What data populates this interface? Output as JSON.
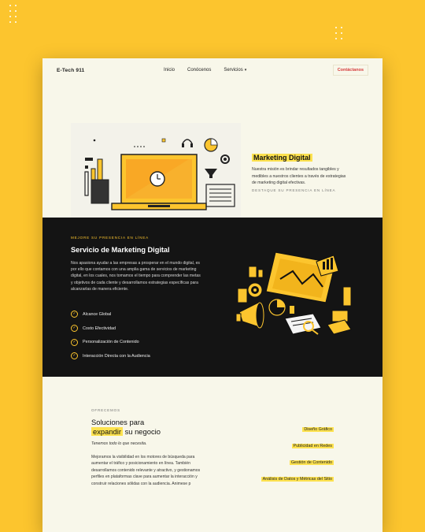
{
  "nav": {
    "brand": "E-Tech 911",
    "links": [
      "Inicio",
      "Conócenos",
      "Servicios"
    ],
    "contact": "Contáctanos"
  },
  "hero": {
    "title": "Marketing Digital",
    "description": "Nuestra misión es brindar resultados tangibles y medibles a nuestros clientes a través de estrategias de marketing digital efectivas.",
    "kicker": "Destaque su presencia en línea"
  },
  "service_section": {
    "kicker": "Mejore su presencia en línea",
    "title": "Servicio de Marketing Digital",
    "description": "Nos apasiona ayudar a las empresas a prosperar en el mundo digital, es por ello que contamos con una amplia gama de servicios de marketing digital, en los cuales, nos tomamos el tiempo para comprender las metas y objetivos de cada cliente y desarrollamos estrategias específicas para alcanzarlas de manera eficiente.",
    "features": [
      "Alcance Global",
      "Costo Efectividad",
      "Personalización de Contenido",
      "Interacción Directa con la Audiencia"
    ]
  },
  "offer_section": {
    "kicker": "Ofrecemos",
    "title_line1": "Soluciones para",
    "title_highlight": "expandir",
    "title_rest": "su negocio",
    "quote": "Tenemos todo lo que necesita.",
    "description": "Mejoramos la visibilidad en los motores de búsqueda para aumentar el tráfico y posicionamiento en línea. También desarrollamos contenido relevante y atractivo, y gestionamos perfiles en plataformas clave para aumentar la interacción y construir relaciones sólidas con la audiencia. Animese p",
    "services": [
      "Diseño Gráfico",
      "Publicidad en Redes",
      "Gestión de Contenido",
      "Análisis de Datos y Métricas del Sitio"
    ]
  },
  "colors": {
    "background": "#fcc52e",
    "page": "#f8f7ea",
    "dark": "#141414",
    "highlight": "#fde24f",
    "accent_red": "#d63b3b"
  }
}
